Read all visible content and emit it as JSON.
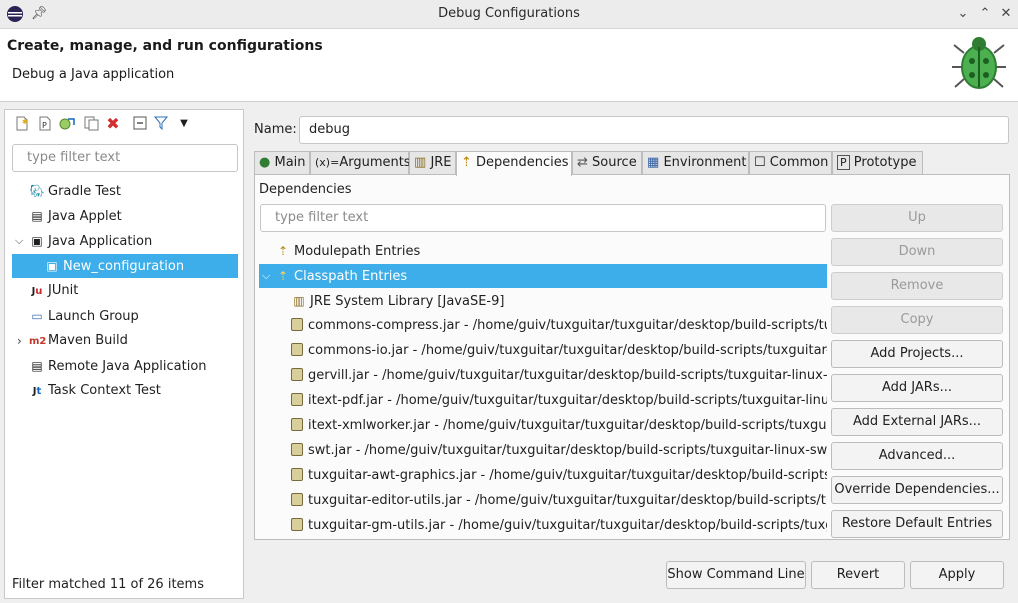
{
  "window": {
    "title": "Debug Configurations",
    "controls": [
      "chevron-down-icon",
      "chevron-up-icon",
      "close-icon"
    ]
  },
  "header": {
    "title": "Create, manage, and run configurations",
    "subtitle": "Debug a Java application"
  },
  "left": {
    "toolbar_icons": [
      "new-config-icon",
      "new-prototype-icon",
      "export-icon",
      "duplicate-icon",
      "delete-icon",
      "collapse-all-icon",
      "filter-icon",
      "dropdown-icon"
    ],
    "filter_placeholder": "type filter text",
    "tree": [
      {
        "label": "Gradle Test",
        "icon": "gradle-icon"
      },
      {
        "label": "Java Applet",
        "icon": "applet-icon"
      },
      {
        "label": "Java Application",
        "icon": "java-app-icon",
        "expanded": true
      },
      {
        "label": "New_configuration",
        "icon": "config-icon",
        "selected": true
      },
      {
        "label": "JUnit",
        "icon": "junit-icon"
      },
      {
        "label": "Launch Group",
        "icon": "launch-group-icon"
      },
      {
        "label": "Maven Build",
        "icon": "maven-icon",
        "collapsed": true
      },
      {
        "label": "Remote Java Application",
        "icon": "remote-icon"
      },
      {
        "label": "Task Context Test",
        "icon": "task-icon"
      }
    ],
    "status": "Filter matched 11 of 26 items"
  },
  "name_label": "Name:",
  "name_value": "debug",
  "tabs": [
    {
      "label": "Main"
    },
    {
      "label": "Arguments"
    },
    {
      "label": "JRE"
    },
    {
      "label": "Dependencies",
      "active": true
    },
    {
      "label": "Source"
    },
    {
      "label": "Environment"
    },
    {
      "label": "Common"
    },
    {
      "label": "Prototype"
    }
  ],
  "dependencies": {
    "heading": "Dependencies",
    "filter_placeholder": "type filter text",
    "entries": [
      {
        "label": "Modulepath Entries",
        "level": 0
      },
      {
        "label": "Classpath Entries",
        "level": 0,
        "selected": true,
        "expanded": true
      },
      {
        "label": "JRE System Library [JavaSE-9]",
        "level": 1
      },
      {
        "label": "commons-compress.jar - /home/guiv/tuxguitar/tuxguitar/desktop/build-scripts/tuxgu",
        "level": 1
      },
      {
        "label": "commons-io.jar - /home/guiv/tuxguitar/tuxguitar/desktop/build-scripts/tuxguitar-linu",
        "level": 1
      },
      {
        "label": "gervill.jar - /home/guiv/tuxguitar/tuxguitar/desktop/build-scripts/tuxguitar-linux-swt",
        "level": 1
      },
      {
        "label": "itext-pdf.jar - /home/guiv/tuxguitar/tuxguitar/desktop/build-scripts/tuxguitar-linux-s",
        "level": 1
      },
      {
        "label": "itext-xmlworker.jar - /home/guiv/tuxguitar/tuxguitar/desktop/build-scripts/tuxguita",
        "level": 1
      },
      {
        "label": "swt.jar - /home/guiv/tuxguitar/tuxguitar/desktop/build-scripts/tuxguitar-linux-swt/ta",
        "level": 1
      },
      {
        "label": "tuxguitar-awt-graphics.jar - /home/guiv/tuxguitar/tuxguitar/desktop/build-scripts/tu",
        "level": 1
      },
      {
        "label": "tuxguitar-editor-utils.jar - /home/guiv/tuxguitar/tuxguitar/desktop/build-scripts/tu",
        "level": 1
      },
      {
        "label": "tuxguitar-gm-utils.jar - /home/guiv/tuxguitar/tuxguitar/desktop/build-scripts/tuxguit",
        "level": 1
      }
    ],
    "buttons": [
      {
        "label": "Up",
        "enabled": false
      },
      {
        "label": "Down",
        "enabled": false
      },
      {
        "label": "Remove",
        "enabled": false
      },
      {
        "label": "Copy",
        "enabled": false
      },
      {
        "label": "Add Projects...",
        "enabled": true
      },
      {
        "label": "Add JARs...",
        "enabled": true
      },
      {
        "label": "Add External JARs...",
        "enabled": true
      },
      {
        "label": "Advanced...",
        "enabled": true
      },
      {
        "label": "Override Dependencies...",
        "enabled": true
      },
      {
        "label": "Restore Default Entries",
        "enabled": true
      }
    ]
  },
  "bottom_buttons": {
    "show_command_line": "Show Command Line",
    "revert": "Revert",
    "apply": "Apply"
  },
  "colors": {
    "selection": "#3daee9",
    "delete_icon": "#d32f2f",
    "maven_icon": "#c0392b"
  }
}
